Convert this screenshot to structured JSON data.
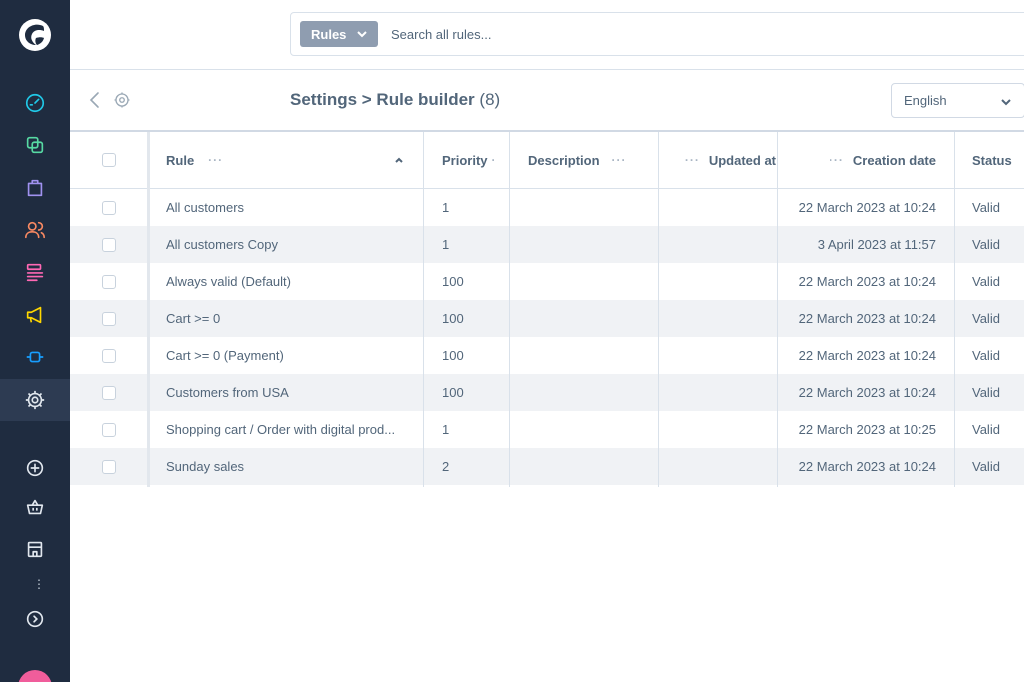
{
  "topbar": {
    "search_type_label": "Rules",
    "search_placeholder": "Search all rules..."
  },
  "smartbar": {
    "title": "Settings > Rule builder",
    "count": "(8)",
    "language": "English"
  },
  "grid": {
    "columns": [
      {
        "label": "Rule"
      },
      {
        "label": "Priority"
      },
      {
        "label": "Description"
      },
      {
        "label": "Updated at"
      },
      {
        "label": "Creation date"
      },
      {
        "label": "Status"
      }
    ],
    "rows": [
      {
        "rule": "All customers",
        "priority": "1",
        "description": "",
        "updated": "",
        "created": "22 March 2023 at 10:24",
        "status": "Valid"
      },
      {
        "rule": "All customers Copy",
        "priority": "1",
        "description": "",
        "updated": "",
        "created": "3 April 2023 at 11:57",
        "status": "Valid"
      },
      {
        "rule": "Always valid (Default)",
        "priority": "100",
        "description": "",
        "updated": "",
        "created": "22 March 2023 at 10:24",
        "status": "Valid"
      },
      {
        "rule": "Cart >= 0",
        "priority": "100",
        "description": "",
        "updated": "",
        "created": "22 March 2023 at 10:24",
        "status": "Valid"
      },
      {
        "rule": "Cart >= 0 (Payment)",
        "priority": "100",
        "description": "",
        "updated": "",
        "created": "22 March 2023 at 10:24",
        "status": "Valid"
      },
      {
        "rule": "Customers from USA",
        "priority": "100",
        "description": "",
        "updated": "",
        "created": "22 March 2023 at 10:24",
        "status": "Valid"
      },
      {
        "rule": "Shopping cart / Order with digital prod...",
        "priority": "1",
        "description": "",
        "updated": "",
        "created": "22 March 2023 at 10:25",
        "status": "Valid"
      },
      {
        "rule": "Sunday sales",
        "priority": "2",
        "description": "",
        "updated": "",
        "created": "22 March 2023 at 10:24",
        "status": "Valid"
      }
    ]
  },
  "sidebar": {
    "items": [
      {
        "icon": "dashboard-icon",
        "color": "#20c9e8"
      },
      {
        "icon": "catalogues-icon",
        "color": "#57d9a3"
      },
      {
        "icon": "orders-icon",
        "color": "#a092f0"
      },
      {
        "icon": "customers-icon",
        "color": "#f88962"
      },
      {
        "icon": "content-icon",
        "color": "#ff68b4"
      },
      {
        "icon": "marketing-icon",
        "color": "#ffd700"
      },
      {
        "icon": "extensions-icon",
        "color": "#189eff"
      },
      {
        "icon": "settings-icon",
        "color": "#b3c2d1"
      },
      {
        "icon": "add-sales-channel-icon",
        "color": "#b3c2d1"
      },
      {
        "icon": "storefront-icon",
        "color": "#b3c2d1"
      },
      {
        "icon": "store-icon",
        "color": "#b3c2d1"
      },
      {
        "icon": "expand-icon",
        "color": "#b3c2d1"
      }
    ]
  }
}
